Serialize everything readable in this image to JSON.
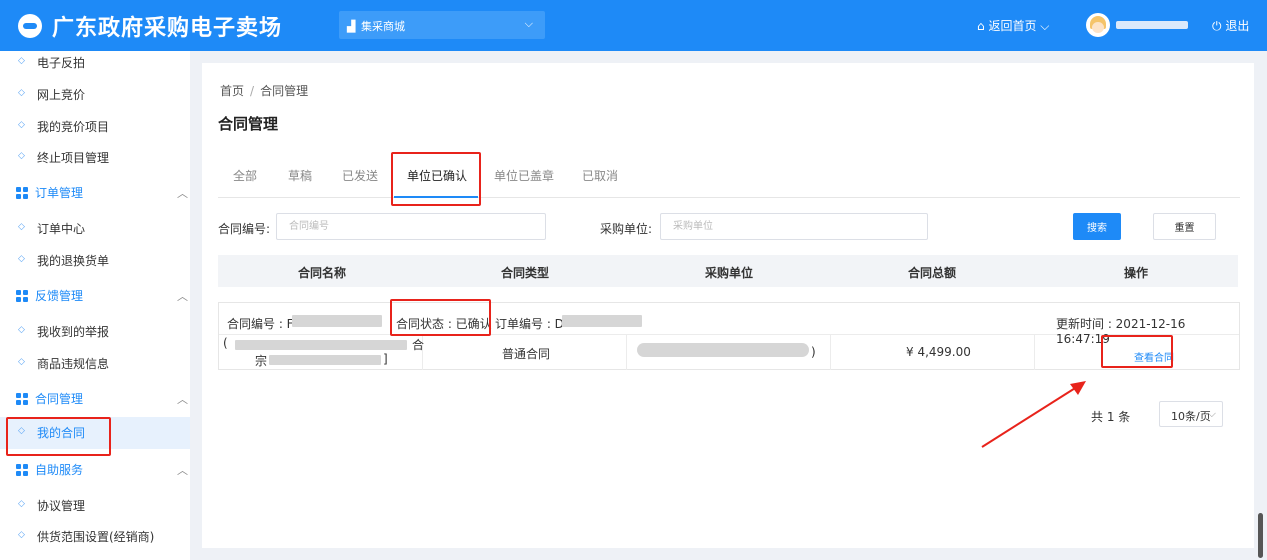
{
  "header": {
    "site_title": "广东政府采购电子卖场",
    "mall_label": "集采商城",
    "home_label": "返回首页 ⌵",
    "logout_label": "退出"
  },
  "sidebar": {
    "items": [
      {
        "label": "电子反拍",
        "type": "item"
      },
      {
        "label": "网上竞价",
        "type": "item"
      },
      {
        "label": "我的竞价项目",
        "type": "item"
      },
      {
        "label": "终止项目管理",
        "type": "item"
      },
      {
        "label": "订单管理",
        "type": "group"
      },
      {
        "label": "订单中心",
        "type": "item"
      },
      {
        "label": "我的退换货单",
        "type": "item"
      },
      {
        "label": "反馈管理",
        "type": "group"
      },
      {
        "label": "我收到的举报",
        "type": "item"
      },
      {
        "label": "商品违规信息",
        "type": "item"
      },
      {
        "label": "合同管理",
        "type": "group"
      },
      {
        "label": "我的合同",
        "type": "item",
        "active": true
      },
      {
        "label": "自助服务",
        "type": "group"
      },
      {
        "label": "协议管理",
        "type": "item"
      },
      {
        "label": "供货范围设置(经销商)",
        "type": "item"
      }
    ]
  },
  "breadcrumb": {
    "home": "首页",
    "sep": "/",
    "current": "合同管理"
  },
  "page_title": "合同管理",
  "tabs": [
    {
      "label": "全部"
    },
    {
      "label": "草稿"
    },
    {
      "label": "已发送"
    },
    {
      "label": "单位已确认",
      "active": true
    },
    {
      "label": "单位已盖章"
    },
    {
      "label": "已取消"
    }
  ],
  "filters": {
    "contract_no_label": "合同编号:",
    "contract_no_placeholder": "合同编号",
    "buyer_label": "采购单位:",
    "buyer_placeholder": "采购单位",
    "search_label": "搜索",
    "reset_label": "重置"
  },
  "table": {
    "columns": [
      "合同名称",
      "合同类型",
      "采购单位",
      "合同总额",
      "操作"
    ],
    "rows": [
      {
        "contract_no": "合同编号 : F",
        "status": "合同状态 : 已确认",
        "order_no": "订单编号 : D",
        "updated": "更新时间 : 2021-12-16 16:47:19",
        "name_line1": "(",
        "name_line1_end": "合",
        "name_line2_start": "宗",
        "name_line2_end": "]",
        "type": "普通合同",
        "buyer_end": ")",
        "amount": "¥ 4,499.00",
        "action": "查看合同"
      }
    ]
  },
  "pagination": {
    "total": "共 1 条",
    "page_size": "10条/页"
  },
  "colors": {
    "primary": "#1e8af7",
    "highlight": "#e8231b",
    "sidebar_active_bg": "#e7f1fd"
  }
}
